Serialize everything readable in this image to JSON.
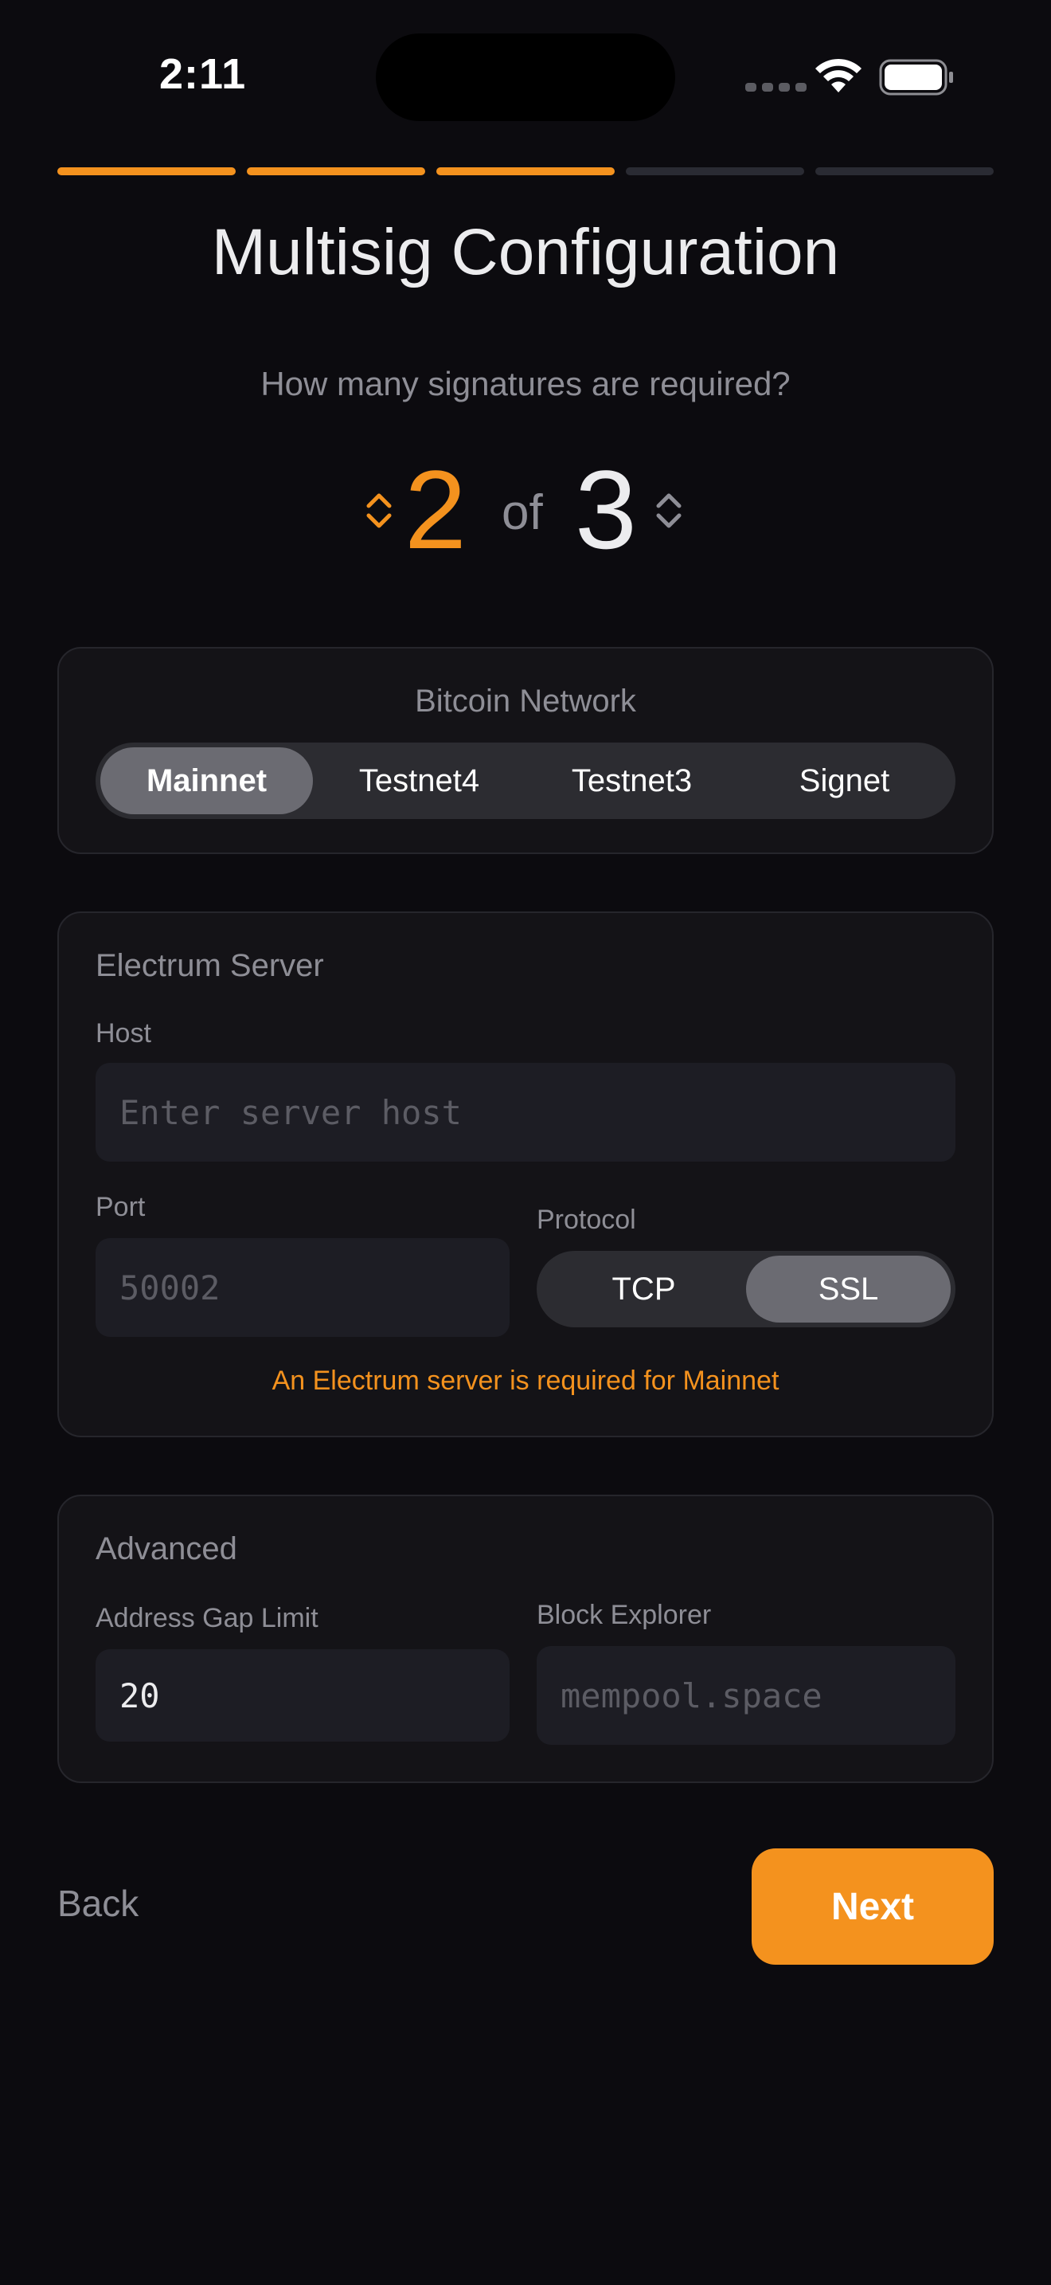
{
  "status_bar": {
    "time": "2:11"
  },
  "progress": {
    "total_steps": 5,
    "completed_steps": 3
  },
  "title": "Multisig Configuration",
  "subtitle": "How many signatures are required?",
  "signatures": {
    "required": "2",
    "of_label": "of",
    "total": "3"
  },
  "network": {
    "label": "Bitcoin Network",
    "options": [
      "Mainnet",
      "Testnet4",
      "Testnet3",
      "Signet"
    ],
    "selected": "Mainnet"
  },
  "electrum": {
    "title": "Electrum Server",
    "host_label": "Host",
    "host_placeholder": "Enter server host",
    "port_label": "Port",
    "port_placeholder": "50002",
    "protocol_label": "Protocol",
    "protocol_options": [
      "TCP",
      "SSL"
    ],
    "protocol_selected": "SSL",
    "warning": "An Electrum server is required for Mainnet"
  },
  "advanced": {
    "title": "Advanced",
    "gap_limit_label": "Address Gap Limit",
    "gap_limit_value": "20",
    "explorer_label": "Block Explorer",
    "explorer_placeholder": "mempool.space"
  },
  "footer": {
    "back_label": "Back",
    "next_label": "Next"
  },
  "colors": {
    "accent": "#f4921e",
    "background": "#0c0b0f",
    "card": "#141317"
  }
}
